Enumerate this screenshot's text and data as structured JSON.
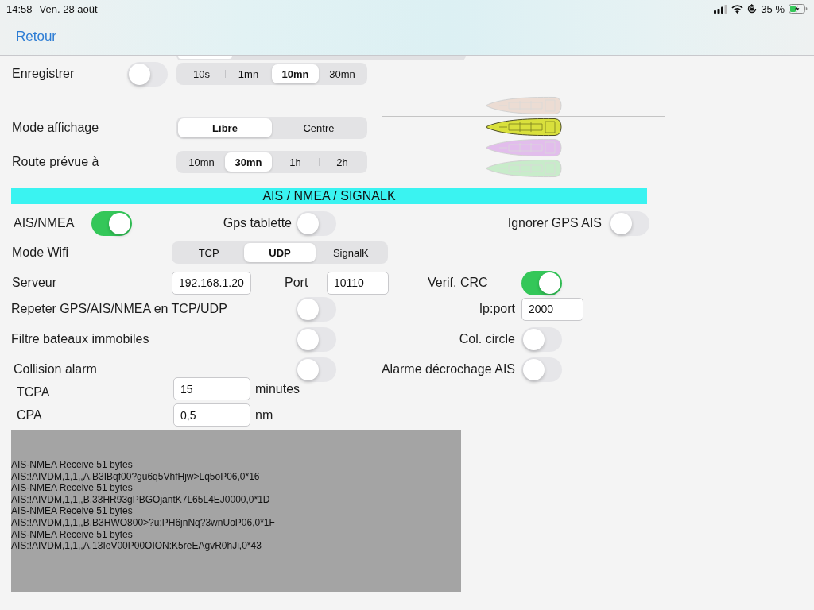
{
  "status_bar": {
    "time": "14:58",
    "date": "Ven. 28 août",
    "battery": "35 %"
  },
  "nav_bar": {
    "back": "Retour"
  },
  "display_settings": {
    "record": {
      "label": "Enregistrer",
      "on": false,
      "intervals": [
        {
          "label": "10s",
          "selected": false
        },
        {
          "label": "1mn",
          "selected": false
        },
        {
          "label": "10mn",
          "selected": true
        },
        {
          "label": "30mn",
          "selected": false
        }
      ]
    },
    "display_mode": {
      "label": "Mode affichage",
      "options": [
        {
          "label": "Libre",
          "selected": true
        },
        {
          "label": "Centré",
          "selected": false
        }
      ]
    },
    "route": {
      "label": "Route prévue à",
      "options": [
        {
          "label": "10mn",
          "selected": false
        },
        {
          "label": "30mn",
          "selected": true
        },
        {
          "label": "1h",
          "selected": false
        },
        {
          "label": "2h",
          "selected": false
        }
      ]
    },
    "boat_picker": [
      {
        "color": "#ecdcd3",
        "selected": false
      },
      {
        "color": "#d9e03c",
        "selected": true
      },
      {
        "color": "#e2bdec",
        "selected": false
      },
      {
        "color": "#c8ecca",
        "selected": false
      }
    ]
  },
  "ais_section": {
    "title": "AIS / NMEA / SIGNALK",
    "ais_nmea": {
      "label": "AIS/NMEA",
      "on": true
    },
    "gps_tablette": {
      "label": "Gps tablette",
      "on": false
    },
    "ignore_gps_ais": {
      "label": "Ignorer GPS AIS",
      "on": false
    },
    "wifi_mode": {
      "label": "Mode Wifi",
      "options": [
        {
          "label": "TCP",
          "selected": false
        },
        {
          "label": "UDP",
          "selected": true
        },
        {
          "label": "SignalK",
          "selected": false
        }
      ]
    },
    "server": {
      "label": "Serveur",
      "value": "192.168.1.20"
    },
    "port": {
      "label": "Port",
      "value": "10110"
    },
    "crc_check": {
      "label": "Verif. CRC",
      "on": true
    },
    "repeat": {
      "label": "Repeter GPS/AIS/NMEA en TCP/UDP",
      "on": false
    },
    "ip_port": {
      "label": "Ip:port",
      "value": "2000"
    },
    "filter_stationary": {
      "label": "Filtre bateaux immobiles",
      "on": false
    },
    "col_circle": {
      "label": "Col. circle",
      "on": false
    },
    "collision_alarm": {
      "label": "Collision alarm",
      "on": false
    },
    "drag_alarm": {
      "label": "Alarme décrochage AIS",
      "on": false
    },
    "tcpa": {
      "label": "TCPA",
      "value": "15",
      "unit": "minutes"
    },
    "cpa": {
      "label": "CPA",
      "value": "0,5",
      "unit": "nm"
    }
  },
  "log": {
    "lines": [
      "AIS-NMEA Receive 51 bytes",
      "AIS:!AIVDM,1,1,,A,B3IBqf00?gu6q5VhfHjw>Lq5oP06,0*16",
      "AIS-NMEA Receive 51 bytes",
      "AIS:!AIVDM,1,1,,B,33HR93gPBGOjantK7L65L4EJ0000,0*1D",
      "AIS-NMEA Receive 51 bytes",
      "AIS:!AIVDM,1,1,,B,B3HWO800>?u;PH6jnNq?3wnUoP06,0*1F",
      "AIS-NMEA Receive 51 bytes",
      "AIS:!AIVDM,1,1,,A,13IeV00P00OION:K5reEAgvR0hJi,0*43"
    ]
  }
}
